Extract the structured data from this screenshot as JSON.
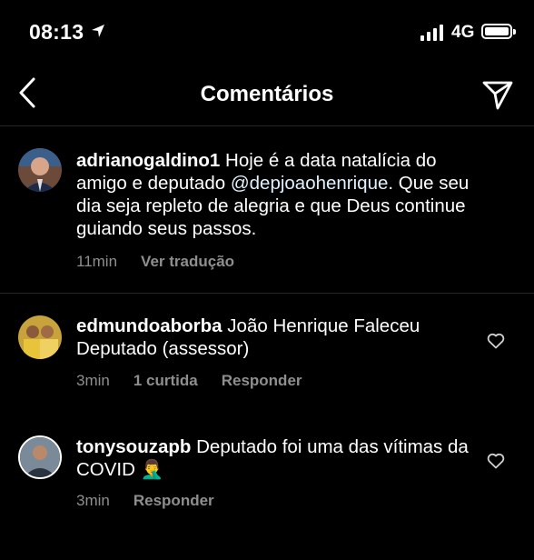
{
  "status_bar": {
    "time": "08:13",
    "network": "4G"
  },
  "header": {
    "title": "Comentários"
  },
  "comments": [
    {
      "username": "adrianogaldino1",
      "text_before": " Hoje é a data natalícia do amigo e deputado ",
      "mention": "@depjoaohenrique",
      "text_after": ". Que seu dia seja repleto de alegria e que Deus continue guiando seus passos.",
      "time": "11min",
      "translate": "Ver tradução"
    },
    {
      "username": "edmundoaborba",
      "text": " João Henrique Faleceu Deputado (assessor)",
      "time": "3min",
      "likes": "1 curtida",
      "reply": "Responder"
    },
    {
      "username": "tonysouzapb",
      "text": " Deputado foi uma das vítimas da COVID ",
      "emoji": "🤦‍♂️",
      "time": "3min",
      "reply": "Responder"
    }
  ]
}
